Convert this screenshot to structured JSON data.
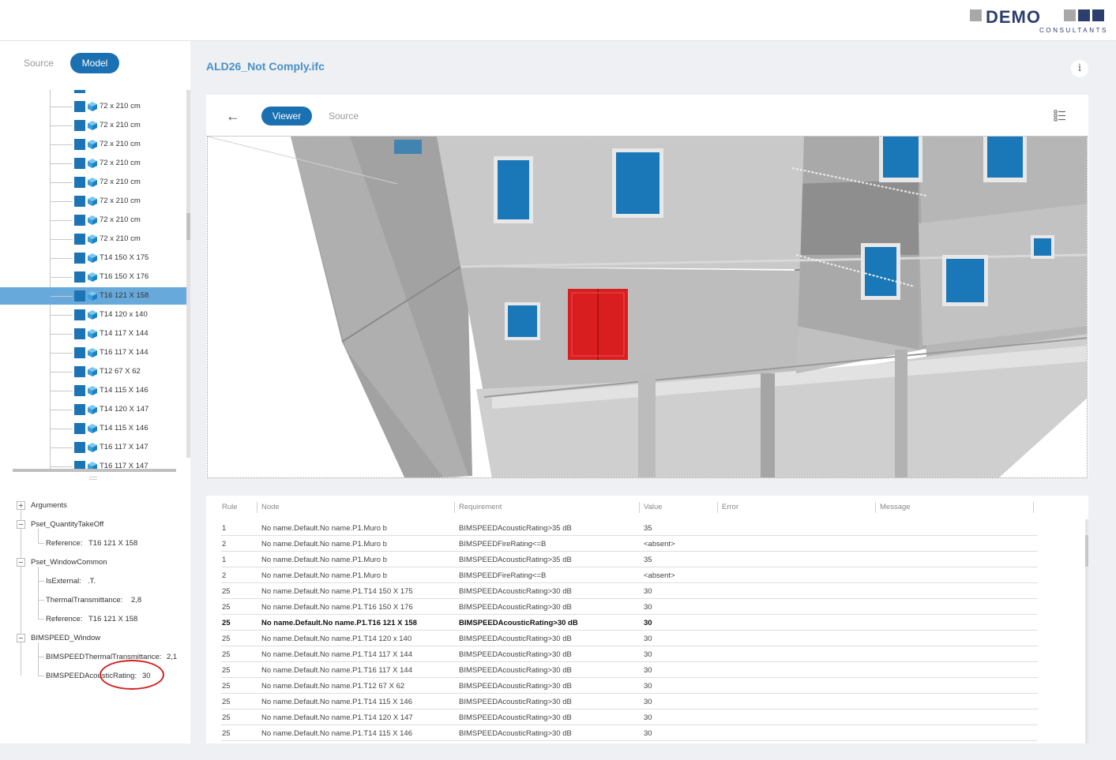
{
  "logo": {
    "word": "DEMO",
    "sub": "CONSULTANTS"
  },
  "left_tabs": {
    "source": "Source",
    "model": "Model"
  },
  "tree_items": [
    "72 x 210 cm",
    "72 x 210 cm",
    "72 x 210 cm",
    "72 x 210 cm",
    "72 x 210 cm",
    "72 x 210 cm",
    "72 x 210 cm",
    "72 x 210 cm",
    "T14 150 X 175",
    "T16 150 X 176",
    "T16 121 X 158",
    "T14 120 x 140",
    "T14 117 X 144",
    "T16 117 X 144",
    "T12 67 X 62",
    "T14 115 X 146",
    "T14 120 X 147",
    "T14 115 X 146",
    "T16 117 X 147",
    "T16 117 X 147"
  ],
  "props": {
    "arguments": "Arguments",
    "pset_qto": "Pset_QuantityTakeOff",
    "qto_reference_label": "Reference:",
    "qto_reference_value": "T16 121 X 158",
    "pset_window": "Pset_WindowCommon",
    "is_external_label": "IsExternal:",
    "is_external_value": ".T.",
    "thermal_label": "ThermalTransmittance:",
    "thermal_value": "2,8",
    "win_reference_label": "Reference:",
    "win_reference_value": "T16 121 X 158",
    "bimspeed_window": "BIMSPEED_Window",
    "bs_thermal_label": "BIMSPEEDThermalTransmittance:",
    "bs_thermal_value": "2,1",
    "bs_acoustic_label": "BIMSPEEDAcousticRating:",
    "bs_acoustic_value": "30"
  },
  "file_title": "ALD26_Not Comply.ifc",
  "info_glyph": "i",
  "viewer_tabs": {
    "viewer": "Viewer",
    "source": "Source"
  },
  "back_glyph": "←",
  "table": {
    "headers": [
      "Rule",
      "Node",
      "Requirement",
      "Value",
      "Error",
      "Message"
    ],
    "rows": [
      {
        "rule": "1",
        "node": "No name.Default.No name.P1.Muro b",
        "req": "BIMSPEEDAcousticRating>35 dB",
        "value": "35"
      },
      {
        "rule": "2",
        "node": "No name.Default.No name.P1.Muro b",
        "req": "BIMSPEEDFireRating<=B",
        "value": "<absent>"
      },
      {
        "rule": "1",
        "node": "No name.Default.No name.P1.Muro b",
        "req": "BIMSPEEDAcousticRating>35 dB",
        "value": "35"
      },
      {
        "rule": "2",
        "node": "No name.Default.No name.P1.Muro b",
        "req": "BIMSPEEDFireRating<=B",
        "value": "<absent>"
      },
      {
        "rule": "25",
        "node": "No name.Default.No name.P1.T14 150 X 175",
        "req": "BIMSPEEDAcousticRating>30 dB",
        "value": "30"
      },
      {
        "rule": "25",
        "node": "No name.Default.No name.P1.T16 150 X 176",
        "req": "BIMSPEEDAcousticRating>30 dB",
        "value": "30"
      },
      {
        "rule": "25",
        "node": "No name.Default.No name.P1.T16 121 X 158",
        "req": "BIMSPEEDAcousticRating>30 dB",
        "value": "30"
      },
      {
        "rule": "25",
        "node": "No name.Default.No name.P1.T14 120 x 140",
        "req": "BIMSPEEDAcousticRating>30 dB",
        "value": "30"
      },
      {
        "rule": "25",
        "node": "No name.Default.No name.P1.T14 117 X 144",
        "req": "BIMSPEEDAcousticRating>30 dB",
        "value": "30"
      },
      {
        "rule": "25",
        "node": "No name.Default.No name.P1.T16 117 X 144",
        "req": "BIMSPEEDAcousticRating>30 dB",
        "value": "30"
      },
      {
        "rule": "25",
        "node": "No name.Default.No name.P1.T12 67 X 62",
        "req": "BIMSPEEDAcousticRating>30 dB",
        "value": "30"
      },
      {
        "rule": "25",
        "node": "No name.Default.No name.P1.T14 115 X 146",
        "req": "BIMSPEEDAcousticRating>30 dB",
        "value": "30"
      },
      {
        "rule": "25",
        "node": "No name.Default.No name.P1.T14 120 X 147",
        "req": "BIMSPEEDAcousticRating>30 dB",
        "value": "30"
      },
      {
        "rule": "25",
        "node": "No name.Default.No name.P1.T14 115 X 146",
        "req": "BIMSPEEDAcousticRating>30 dB",
        "value": "30"
      }
    ]
  },
  "colors": {
    "accent": "#1a70b0",
    "selected_row": "#68a9db",
    "highlight_window": "#d81e1e",
    "glass": "#1a78b8"
  }
}
